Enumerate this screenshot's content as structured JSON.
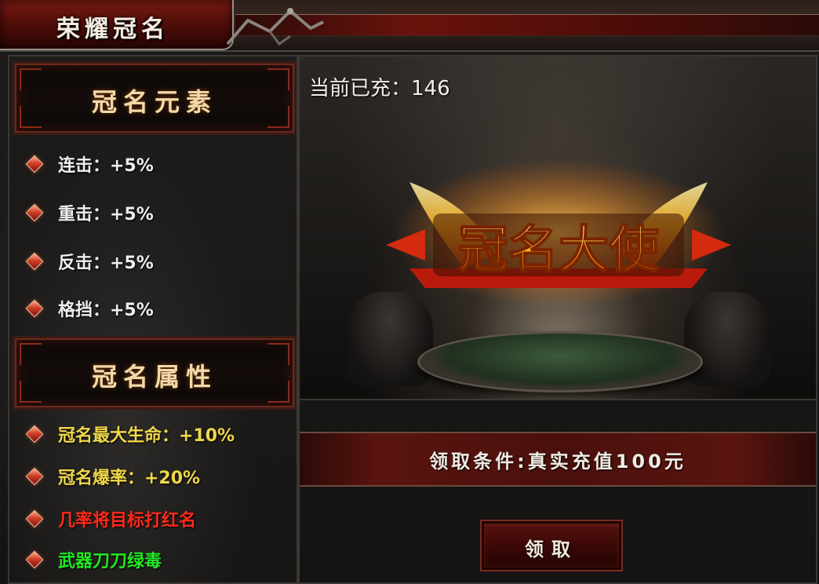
{
  "header": {
    "title": "荣耀冠名"
  },
  "left_panel": {
    "elements_title": "冠名元素",
    "elements": [
      {
        "text": "连击：+5%",
        "color": "#eeeeee"
      },
      {
        "text": "重击：+5%",
        "color": "#eeeeee"
      },
      {
        "text": "反击：+5%",
        "color": "#eeeeee"
      },
      {
        "text": "格挡：+5%",
        "color": "#eeeeee"
      }
    ],
    "attributes_title": "冠名属性",
    "attributes": [
      {
        "text": "冠名最大生命：+10%",
        "color": "#f0d848"
      },
      {
        "text": "冠名爆率：+20%",
        "color": "#f0d848"
      },
      {
        "text": "几率将目标打红名",
        "color": "#ff2a1a"
      },
      {
        "text": "武器刀刀绿毒",
        "color": "#22e822"
      }
    ]
  },
  "right_panel": {
    "recharged": "当前已充：146",
    "emblem_text": "冠名大使",
    "condition": "领取条件:真实充值100元",
    "claim_label": "领取"
  },
  "colors": {
    "accent_red": "#5a140e",
    "gold": "#f0d848",
    "red_text": "#ff2a1a",
    "green_text": "#22e822"
  }
}
